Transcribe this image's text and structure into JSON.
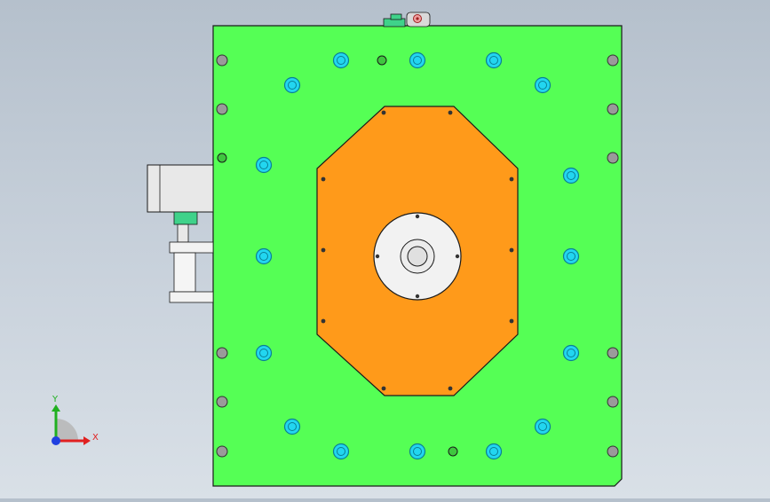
{
  "viewport": {
    "background_top": "#b5c0cc",
    "background_bottom": "#d9e0e7"
  },
  "colors": {
    "base_plate": "#55ff55",
    "base_plate_edge": "#1a1a1a",
    "center_plate": "#ff9a1a",
    "bolt_head": "#22d6f0",
    "bolt_ring": "#0b7f95",
    "through_hole": "#9a9a9a",
    "bearing_face": "#f2f2f2",
    "motor_body": "#e8e8e8",
    "coupling_green": "#3fd28a"
  },
  "triad": {
    "x_label": "X",
    "y_label": "Y",
    "x_color": "#e02020",
    "y_color": "#20b020",
    "z_color": "#2040e0"
  }
}
